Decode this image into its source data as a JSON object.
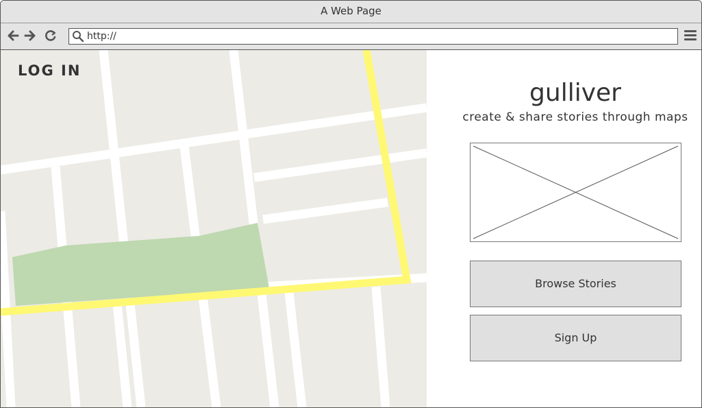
{
  "window": {
    "title": "A Web Page"
  },
  "browser": {
    "url": "http://",
    "back_icon": "arrow-left-icon",
    "forward_icon": "arrow-right-icon",
    "reload_icon": "reload-icon",
    "menu_icon": "hamburger-menu-icon"
  },
  "map": {
    "login_label": "LOG IN",
    "colors": {
      "land": "#ecebe5",
      "road": "#ffffff",
      "highway": "#fff873",
      "park": "#bed8b0"
    }
  },
  "panel": {
    "app_name": "gulliver",
    "tagline": "create & share stories through maps",
    "image_placeholder": "image-placeholder",
    "browse_label": "Browse Stories",
    "signup_label": "Sign Up"
  }
}
